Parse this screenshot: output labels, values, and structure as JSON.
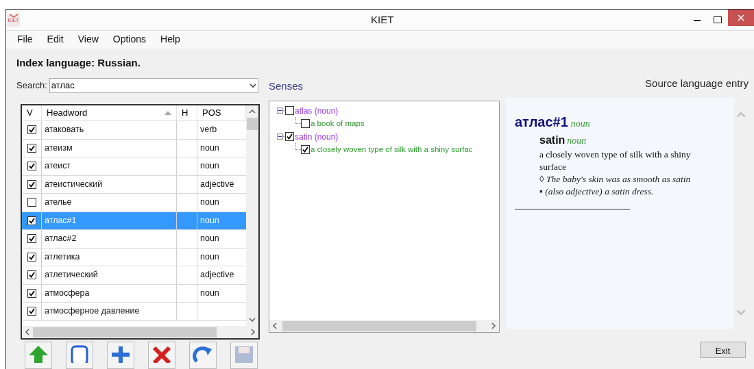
{
  "window": {
    "title": "KIET",
    "logo_text": "KIET"
  },
  "menu": [
    "File",
    "Edit",
    "View",
    "Options",
    "Help"
  ],
  "index_language": "Index language: Russian.",
  "search": {
    "label": "Search:",
    "value": "атлас"
  },
  "grid": {
    "columns": [
      {
        "label": "V",
        "sorted": false
      },
      {
        "label": "Headword",
        "sorted": true
      },
      {
        "label": "H",
        "sorted": false
      },
      {
        "label": "POS",
        "sorted": false
      }
    ],
    "rows": [
      {
        "checked": true,
        "headword": "атаковать",
        "pos": "verb",
        "selected": false
      },
      {
        "checked": true,
        "headword": "атеизм",
        "pos": "noun",
        "selected": false
      },
      {
        "checked": true,
        "headword": "атеист",
        "pos": "noun",
        "selected": false
      },
      {
        "checked": true,
        "headword": "атеистический",
        "pos": "adjective",
        "selected": false
      },
      {
        "checked": false,
        "headword": "ателье",
        "pos": "noun",
        "selected": false
      },
      {
        "checked": true,
        "headword": "атлас#1",
        "pos": "noun",
        "selected": true
      },
      {
        "checked": true,
        "headword": "атлас#2",
        "pos": "noun",
        "selected": false
      },
      {
        "checked": true,
        "headword": "атлетика",
        "pos": "noun",
        "selected": false
      },
      {
        "checked": true,
        "headword": "атлетический",
        "pos": "adjective",
        "selected": false
      },
      {
        "checked": true,
        "headword": "атмосфера",
        "pos": "noun",
        "selected": false
      },
      {
        "checked": true,
        "headword": "атмосферное давление",
        "selected": false
      }
    ]
  },
  "toolbar": [
    {
      "kind": "up",
      "disabled": false
    },
    {
      "kind": "copy",
      "disabled": false
    },
    {
      "kind": "add",
      "disabled": false
    },
    {
      "kind": "delete",
      "disabled": false
    },
    {
      "kind": "redo",
      "disabled": false
    },
    {
      "kind": "save",
      "disabled": true
    }
  ],
  "senses": {
    "title": "Senses",
    "tree": [
      {
        "label": "atlas (noun)",
        "checked": false,
        "expanded": true,
        "children": [
          {
            "label": "a book of maps",
            "checked": false
          }
        ]
      },
      {
        "label": "satin (noun)",
        "checked": true,
        "expanded": true,
        "children": [
          {
            "label": "a closely woven type of silk with a shiny surfac",
            "checked": true
          }
        ]
      }
    ]
  },
  "entry": {
    "title": "Source language entry",
    "headword": "атлас#1",
    "pos": "noun",
    "senses": [
      {
        "word": "satin",
        "pos": "noun",
        "definition": "a closely woven type of silk with a shiny surface",
        "example": "◊ The baby's skin was as smooth as satin ▪ (also adjective) a satin dress."
      }
    ]
  },
  "exit_button": "Exit"
}
